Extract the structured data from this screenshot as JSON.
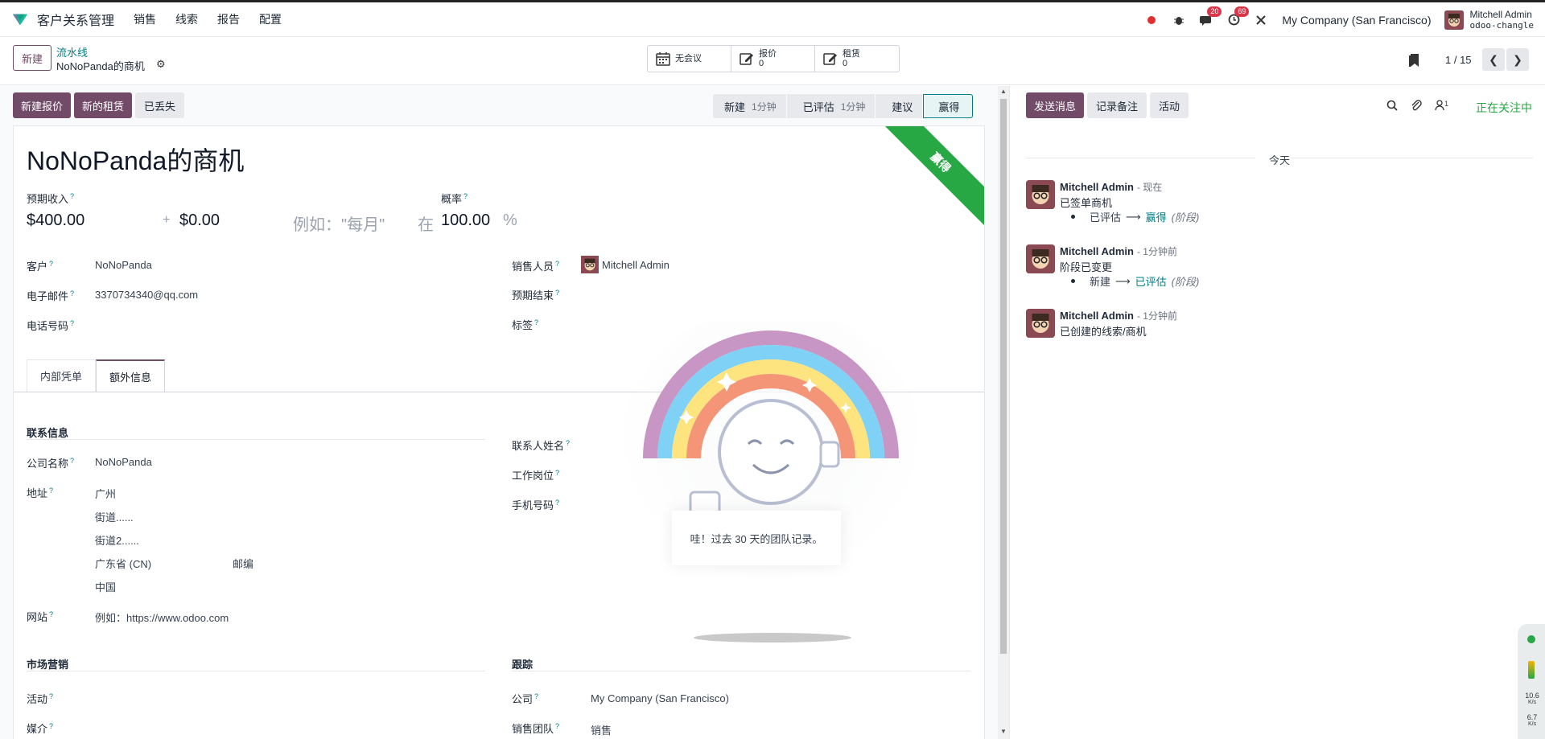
{
  "topbar": {
    "app_name": "客户关系管理",
    "menu": [
      "销售",
      "线索",
      "报告",
      "配置"
    ],
    "chat_badge": "20",
    "activity_badge": "69",
    "company": "My Company (San Francisco)",
    "user_name": "Mitchell Admin",
    "db_name": "odoo-changle"
  },
  "control": {
    "new_button": "新建",
    "breadcrumb_parent": "流水线",
    "breadcrumb_current": "NoNoPanda的商机",
    "smart_buttons": [
      {
        "label": "无会议",
        "value": ""
      },
      {
        "label": "报价",
        "value": "0"
      },
      {
        "label": "租赁",
        "value": "0"
      }
    ],
    "pager": "1 / 15"
  },
  "actions": {
    "new_quote": "新建报价",
    "new_rental": "新的租赁",
    "lost": "已丢失"
  },
  "stages": [
    {
      "label": "新建",
      "duration": "1分钟"
    },
    {
      "label": "已评估",
      "duration": "1分钟"
    },
    {
      "label": "建议",
      "duration": ""
    },
    {
      "label": "赢得",
      "duration": ""
    }
  ],
  "form": {
    "ribbon": "赢得",
    "title": "NoNoPanda的商机",
    "expected_revenue_label": "预期收入",
    "probability_label": "概率",
    "expected_revenue": "$400.00",
    "plus": "+",
    "recurring": "$0.00",
    "recurring_placeholder": "例如：\"每月\"",
    "at": "在",
    "probability": "100.00",
    "percent": "%",
    "customer_label": "客户",
    "customer": "NoNoPanda",
    "email_label": "电子邮件",
    "email": "3370734340@qq.com",
    "phone_label": "电话号码",
    "salesperson_label": "销售人员",
    "salesperson": "Mitchell Admin",
    "deadline_label": "预期结束",
    "tags_label": "标签",
    "tabs": [
      "内部凭单",
      "额外信息"
    ],
    "contact_section": "联系信息",
    "company_name_label": "公司名称",
    "company_name": "NoNoPanda",
    "address_label": "地址",
    "address_city": "广州",
    "address_street": "街道......",
    "address_street2": "街道2......",
    "address_state": "广东省 (CN)",
    "address_zip": "邮编",
    "address_country": "中国",
    "website_label": "网站",
    "website_placeholder": "例如：https://www.odoo.com",
    "contact_name_label": "联系人姓名",
    "job_label": "工作岗位",
    "mobile_label": "手机号码",
    "marketing_section": "市场营销",
    "campaign_label": "活动",
    "medium_label": "媒介",
    "tracking_section": "跟踪",
    "company_label": "公司",
    "company_value": "My Company (San Francisco)",
    "team_label": "销售团队",
    "team_value": "销售"
  },
  "rainbow": {
    "message": "哇！过去 30 天的团队记录。"
  },
  "chatter": {
    "send_message": "发送消息",
    "log_note": "记录备注",
    "activity": "活动",
    "follower_count": "1",
    "following": "正在关注中",
    "today": "今天",
    "messages": [
      {
        "author": "Mitchell Admin",
        "time": "- 现在",
        "body": "已签单商机",
        "old": "已评估",
        "new": "赢得",
        "field": "(阶段)"
      },
      {
        "author": "Mitchell Admin",
        "time": "- 1分钟前",
        "body": "阶段已变更",
        "old": "新建",
        "new": "已评估",
        "field": "(阶段)"
      },
      {
        "author": "Mitchell Admin",
        "time": "- 1分钟前",
        "body": "已创建的线索/商机",
        "old": "",
        "new": "",
        "field": ""
      }
    ]
  },
  "widget": {
    "up": "10.6",
    "up_unit": "K/s",
    "down": "6.7",
    "down_unit": "K/s"
  }
}
